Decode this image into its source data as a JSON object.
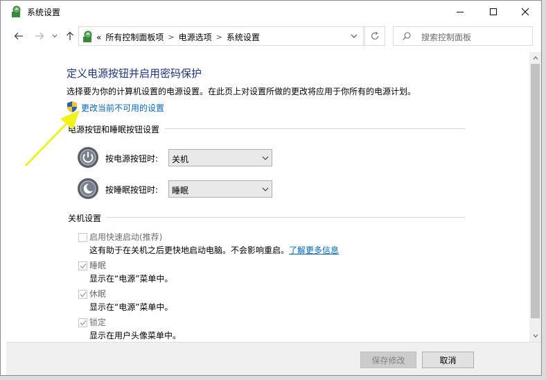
{
  "window": {
    "title": "系统设置"
  },
  "address": {
    "overflow": "«",
    "crumbs": [
      "所有控制面板项",
      "电源选项",
      "系统设置"
    ],
    "search_placeholder": "搜索控制面板"
  },
  "main": {
    "heading": "定义电源按钮并启用密码保护",
    "description": "选择要为你的计算机设置的电源设置。在此页上对设置所做的更改将应用于你所有的电源计划。",
    "change_link": "更改当前不可用的设置",
    "power_section": {
      "title": "电源按钮和睡眠按钮设置",
      "power_button_label": "按电源按钮时:",
      "power_button_value": "关机",
      "sleep_button_label": "按睡眠按钮时:",
      "sleep_button_value": "睡眠"
    },
    "shutdown_section": {
      "title": "关机设置",
      "options": [
        {
          "label": "启用快速启动(推荐)",
          "desc": "这有助于在关机之后更快地启动电脑。不会影响重启。",
          "link": "了解更多信息",
          "checked": false
        },
        {
          "label": "睡眠",
          "desc": "显示在“电源”菜单中。",
          "checked": true
        },
        {
          "label": "休眠",
          "desc": "显示在“电源”菜单中。",
          "checked": true
        },
        {
          "label": "锁定",
          "desc": "显示在用户头像菜单中。",
          "checked": true
        }
      ]
    }
  },
  "footer": {
    "save_label": "保存修改",
    "cancel_label": "取消"
  },
  "colors": {
    "heading": "#1e3287",
    "link": "#0066cc",
    "annotation_arrow": "#f2f21a"
  }
}
